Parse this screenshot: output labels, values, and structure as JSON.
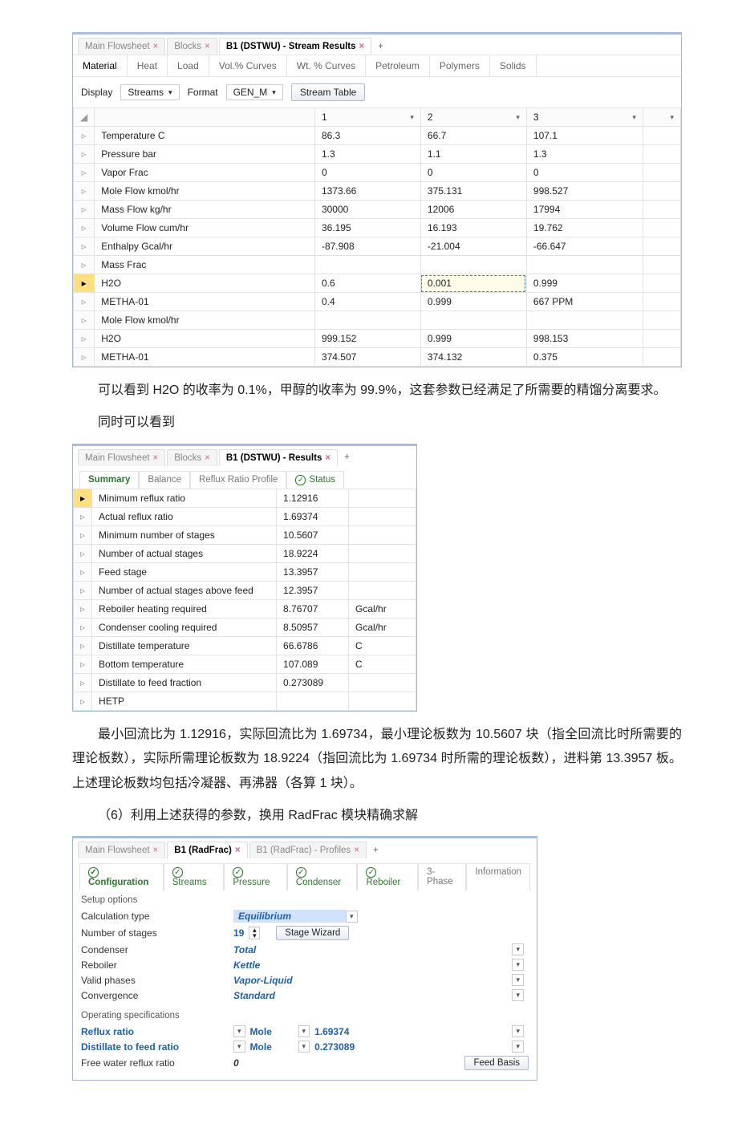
{
  "panelA": {
    "tabs": [
      "Main Flowsheet",
      "Blocks",
      "B1 (DSTWU) - Stream Results"
    ],
    "activeTab": 2,
    "subtabs": [
      "Material",
      "Heat",
      "Load",
      "Vol.% Curves",
      "Wt. % Curves",
      "Petroleum",
      "Polymers",
      "Solids"
    ],
    "display_label": "Display",
    "display_value": "Streams",
    "format_label": "Format",
    "format_value": "GEN_M",
    "streamtable_button": "Stream Table",
    "columns": [
      "1",
      "2",
      "3"
    ],
    "rows": [
      {
        "name": "Temperature C",
        "v": [
          "86.3",
          "66.7",
          "107.1"
        ]
      },
      {
        "name": "Pressure bar",
        "v": [
          "1.3",
          "1.1",
          "1.3"
        ]
      },
      {
        "name": "Vapor Frac",
        "v": [
          "0",
          "0",
          "0"
        ]
      },
      {
        "name": "Mole Flow kmol/hr",
        "v": [
          "1373.66",
          "375.131",
          "998.527"
        ]
      },
      {
        "name": "Mass Flow kg/hr",
        "v": [
          "30000",
          "12006",
          "17994"
        ]
      },
      {
        "name": "Volume Flow cum/hr",
        "v": [
          "36.195",
          "16.193",
          "19.762"
        ]
      },
      {
        "name": "Enthalpy    Gcal/hr",
        "v": [
          "-87.908",
          "-21.004",
          "-66.647"
        ]
      },
      {
        "name": "Mass Frac",
        "v": [
          "",
          "",
          ""
        ]
      },
      {
        "name": "H2O",
        "v": [
          "0.6",
          "0.001",
          "0.999"
        ],
        "selected": true,
        "highlight_col": 1
      },
      {
        "name": "METHA-01",
        "v": [
          "0.4",
          "0.999",
          "667 PPM"
        ]
      },
      {
        "name": "Mole Flow kmol/hr",
        "v": [
          "",
          "",
          ""
        ]
      },
      {
        "name": "H2O",
        "v": [
          "999.152",
          "0.999",
          "998.153"
        ]
      },
      {
        "name": "METHA-01",
        "v": [
          "374.507",
          "374.132",
          "0.375"
        ]
      }
    ]
  },
  "para1": "可以看到 H2O 的收率为 0.1%，甲醇的收率为 99.9%，这套参数已经满足了所需要的精馏分离要求。",
  "para1b": "同时可以看到",
  "panelB": {
    "tabs": [
      "Main Flowsheet",
      "Blocks",
      "B1 (DSTWU) - Results"
    ],
    "activeTab": 2,
    "subtabs": [
      "Summary",
      "Balance",
      "Reflux Ratio Profile",
      "Status"
    ],
    "rows": [
      {
        "name": "Minimum reflux ratio",
        "val": "1.12916",
        "unit": "",
        "selected": true
      },
      {
        "name": "Actual reflux ratio",
        "val": "1.69374",
        "unit": ""
      },
      {
        "name": "Minimum number of stages",
        "val": "10.5607",
        "unit": ""
      },
      {
        "name": "Number of actual stages",
        "val": "18.9224",
        "unit": ""
      },
      {
        "name": "Feed stage",
        "val": "13.3957",
        "unit": ""
      },
      {
        "name": "Number of actual stages above feed",
        "val": "12.3957",
        "unit": ""
      },
      {
        "name": "Reboiler heating required",
        "val": "8.76707",
        "unit": "Gcal/hr"
      },
      {
        "name": "Condenser cooling required",
        "val": "8.50957",
        "unit": "Gcal/hr"
      },
      {
        "name": "Distillate temperature",
        "val": "66.6786",
        "unit": "C"
      },
      {
        "name": "Bottom temperature",
        "val": "107.089",
        "unit": "C"
      },
      {
        "name": "Distillate to feed fraction",
        "val": "0.273089",
        "unit": ""
      },
      {
        "name": "HETP",
        "val": "",
        "unit": ""
      }
    ]
  },
  "para2": "最小回流比为 1.12916，实际回流比为 1.69734，最小理论板数为 10.5607 块（指全回流比时所需要的理论板数），实际所需理论板数为 18.9224（指回流比为 1.69734 时所需的理论板数），进料第 13.3957 板。上述理论板数均包括冷凝器、再沸器（各算 1 块）。",
  "para3": "（6）利用上述获得的参数，换用 RadFrac 模块精确求解",
  "panelC": {
    "tabs": [
      "Main Flowsheet",
      "B1 (RadFrac)",
      "B1 (RadFrac) - Profiles"
    ],
    "activeTab": 1,
    "subtabs": [
      "Configuration",
      "Streams",
      "Pressure",
      "Condenser",
      "Reboiler",
      "3-Phase",
      "Information"
    ],
    "setup_head": "Setup options",
    "setup": [
      {
        "label": "Calculation type",
        "value": "Equilibrium",
        "style": "sel"
      },
      {
        "label": "Number of stages",
        "value": "19",
        "style": "spin",
        "button": "Stage Wizard"
      },
      {
        "label": "Condenser",
        "value": "Total",
        "style": "dd"
      },
      {
        "label": "Reboiler",
        "value": "Kettle",
        "style": "dd"
      },
      {
        "label": "Valid phases",
        "value": "Vapor-Liquid",
        "style": "dd"
      },
      {
        "label": "Convergence",
        "value": "Standard",
        "style": "dd"
      }
    ],
    "ops_head": "Operating specifications",
    "ops": [
      {
        "label": "Reflux ratio",
        "basis": "Mole",
        "value": "1.69374"
      },
      {
        "label": "Distillate to feed ratio",
        "basis": "Mole",
        "value": "0.273089"
      }
    ],
    "free_water_label": "Free water reflux ratio",
    "free_water_value": "0",
    "feed_basis_button": "Feed Basis"
  },
  "chart_data": [
    {
      "type": "table",
      "title": "B1 (DSTWU) - Stream Results",
      "columns": [
        "",
        "1",
        "2",
        "3"
      ],
      "rows": [
        [
          "Temperature C",
          86.3,
          66.7,
          107.1
        ],
        [
          "Pressure bar",
          1.3,
          1.1,
          1.3
        ],
        [
          "Vapor Frac",
          0,
          0,
          0
        ],
        [
          "Mole Flow kmol/hr",
          1373.66,
          375.131,
          998.527
        ],
        [
          "Mass Flow kg/hr",
          30000,
          12006,
          17994
        ],
        [
          "Volume Flow cum/hr",
          36.195,
          16.193,
          19.762
        ],
        [
          "Enthalpy Gcal/hr",
          -87.908,
          -21.004,
          -66.647
        ],
        [
          "Mass Frac H2O",
          0.6,
          0.001,
          0.999
        ],
        [
          "Mass Frac METHA-01",
          0.4,
          0.999,
          "667 PPM"
        ],
        [
          "Mole Flow H2O kmol/hr",
          999.152,
          0.999,
          998.153
        ],
        [
          "Mole Flow METHA-01 kmol/hr",
          374.507,
          374.132,
          0.375
        ]
      ]
    },
    {
      "type": "table",
      "title": "B1 (DSTWU) - Results Summary",
      "rows": [
        [
          "Minimum reflux ratio",
          1.12916,
          ""
        ],
        [
          "Actual reflux ratio",
          1.69374,
          ""
        ],
        [
          "Minimum number of stages",
          10.5607,
          ""
        ],
        [
          "Number of actual stages",
          18.9224,
          ""
        ],
        [
          "Feed stage",
          13.3957,
          ""
        ],
        [
          "Number of actual stages above feed",
          12.3957,
          ""
        ],
        [
          "Reboiler heating required",
          8.76707,
          "Gcal/hr"
        ],
        [
          "Condenser cooling required",
          8.50957,
          "Gcal/hr"
        ],
        [
          "Distillate temperature",
          66.6786,
          "C"
        ],
        [
          "Bottom temperature",
          107.089,
          "C"
        ],
        [
          "Distillate to feed fraction",
          0.273089,
          ""
        ]
      ]
    }
  ]
}
